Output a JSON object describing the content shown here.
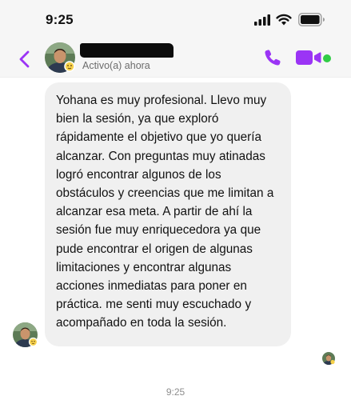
{
  "status_bar": {
    "time": "9:25",
    "icons": [
      "signal-icon",
      "wifi-icon",
      "battery-icon"
    ]
  },
  "header": {
    "back_icon": "chevron-left-icon",
    "contact_name_visible": false,
    "presence": "Activo(a) ahora",
    "actions": [
      "phone-icon",
      "video-camera-icon"
    ],
    "active_indicator_color": "#31cc46",
    "accent_color": "#9b34f5"
  },
  "conversation": {
    "message": {
      "sender": "contact",
      "text": "Yohana es muy profesional. Llevo muy bien la sesión, ya que exploró rápidamente el objetivo que yo quería alcanzar. Con preguntas muy atinadas logró encontrar algunos de los obstáculos y creencias que me limitan a alcanzar esa meta. A partir de ahí la sesión fue muy enriquecedora ya que pude encontrar el origen de algunas limitaciones y encontrar algunas acciones inmediatas para poner en práctica. me senti muy escuchado y acompañado en toda la sesión.",
      "bubble_color": "#f0f0f0"
    },
    "footer_time": "9:25"
  }
}
